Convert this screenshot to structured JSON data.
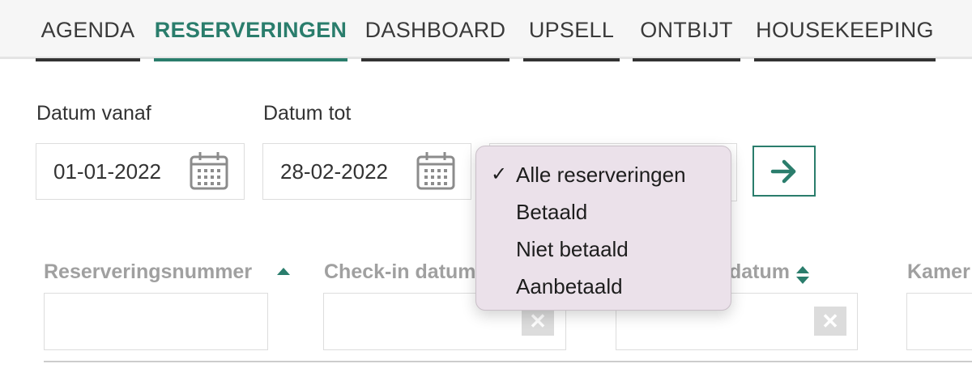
{
  "nav": {
    "tabs": [
      {
        "label": "AGENDA",
        "active": false
      },
      {
        "label": "RESERVERINGEN",
        "active": true
      },
      {
        "label": "DASHBOARD",
        "active": false
      },
      {
        "label": "UPSELL",
        "active": false
      },
      {
        "label": "ONTBIJT",
        "active": false
      },
      {
        "label": "HOUSEKEEPING",
        "active": false
      }
    ]
  },
  "filters": {
    "date_from": {
      "label": "Datum vanaf",
      "value": "01-01-2022",
      "icon": "calendar-icon"
    },
    "date_to": {
      "label": "Datum tot",
      "value": "28-02-2022",
      "icon": "calendar-icon"
    },
    "status_select": {
      "selected": "Alle reserveringen",
      "check_mark": "✓",
      "options": [
        "Alle reserveringen",
        "Betaald",
        "Niet betaald",
        "Aanbetaald"
      ]
    },
    "go_button": {
      "icon": "arrow-right-icon"
    }
  },
  "table": {
    "columns": [
      {
        "label": "Reserveringsnummer",
        "sort_icon": "sort-asc-icon"
      },
      {
        "label": "Check-in datum",
        "sort_icon": "sort-icon"
      },
      {
        "label": "datum",
        "sort_icon": "sort-icon"
      },
      {
        "label": "Kamer",
        "sort_icon": ""
      }
    ],
    "clear_icon": "close-icon"
  },
  "colors": {
    "accent": "#2a7d6c",
    "tab_underline": "#333333",
    "dropdown_bg": "#ebe1ea",
    "header_text_muted": "#a0a0a0"
  }
}
